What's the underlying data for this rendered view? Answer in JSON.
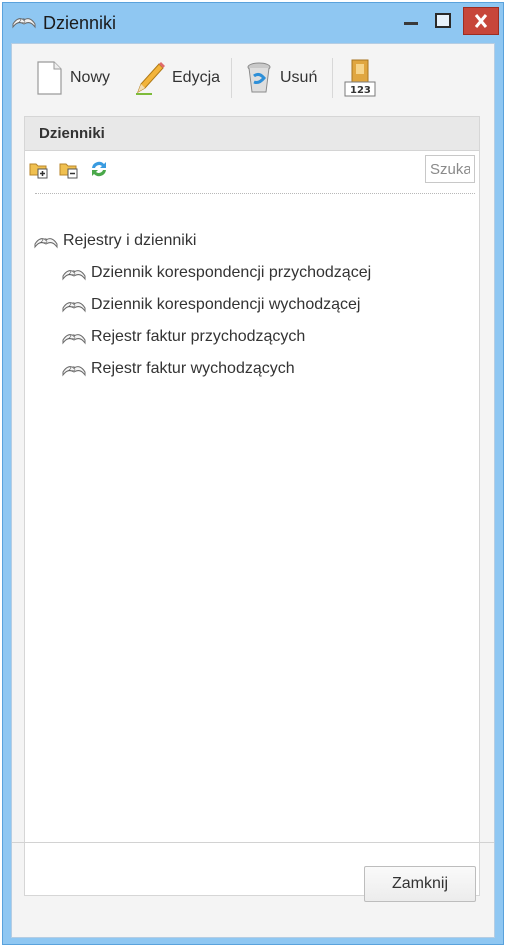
{
  "window": {
    "title": "Dzienniki"
  },
  "toolbar": {
    "new_label": "Nowy",
    "edit_label": "Edycja",
    "delete_label": "Usuń",
    "number_icon_text": "123"
  },
  "panel": {
    "title": "Dzienniki",
    "search_placeholder": "Szukaj"
  },
  "tree": {
    "root": "Rejestry i dzienniki",
    "children": [
      "Dziennik korespondencji przychodzącej",
      "Dziennik korespondencji wychodzącej",
      "Rejestr faktur przychodzących",
      "Rejestr faktur wychodzących"
    ]
  },
  "footer": {
    "close_label": "Zamknij"
  },
  "icons": {
    "journal": "journal-icon",
    "add_folder": "add-folder-icon",
    "remove_folder": "remove-folder-icon",
    "refresh": "refresh-icon",
    "new": "document-icon",
    "edit": "pencil-icon",
    "delete": "trash-icon",
    "numbering": "numbering-icon"
  },
  "colors": {
    "titlebar": "#8fc7f2",
    "close_button": "#c7463a",
    "window_background": "#f4f4f4"
  }
}
